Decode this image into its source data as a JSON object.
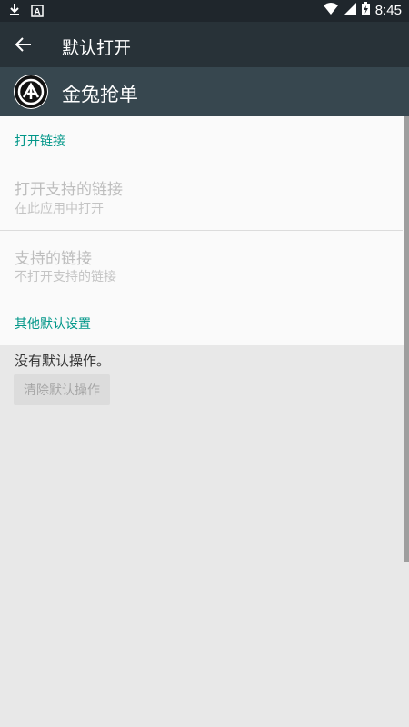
{
  "status_bar": {
    "time": "8:45",
    "icons": [
      "download-notification-icon",
      "a-notification-icon",
      "wifi-icon",
      "cell-signal-icon",
      "battery-charging-icon"
    ]
  },
  "toolbar": {
    "title": "默认打开",
    "back_icon": "arrow-left-icon"
  },
  "app": {
    "name": "金兔抢单",
    "icon": "app-logo-icon"
  },
  "sections": {
    "open_links": {
      "header": "打开链接",
      "open_supported": {
        "title": "打开支持的链接",
        "summary": "在此应用中打开"
      },
      "supported_links": {
        "title": "支持的链接",
        "summary": "不打开支持的链接"
      }
    },
    "other_defaults": {
      "header": "其他默认设置",
      "no_default_text": "没有默认操作。",
      "clear_button": "清除默认操作"
    }
  },
  "colors": {
    "status_bar": "#1f262c",
    "toolbar": "#283238",
    "app_header": "#37474f",
    "accent": "#009688",
    "panel": "#fafafa",
    "background": "#e8e8e8"
  }
}
